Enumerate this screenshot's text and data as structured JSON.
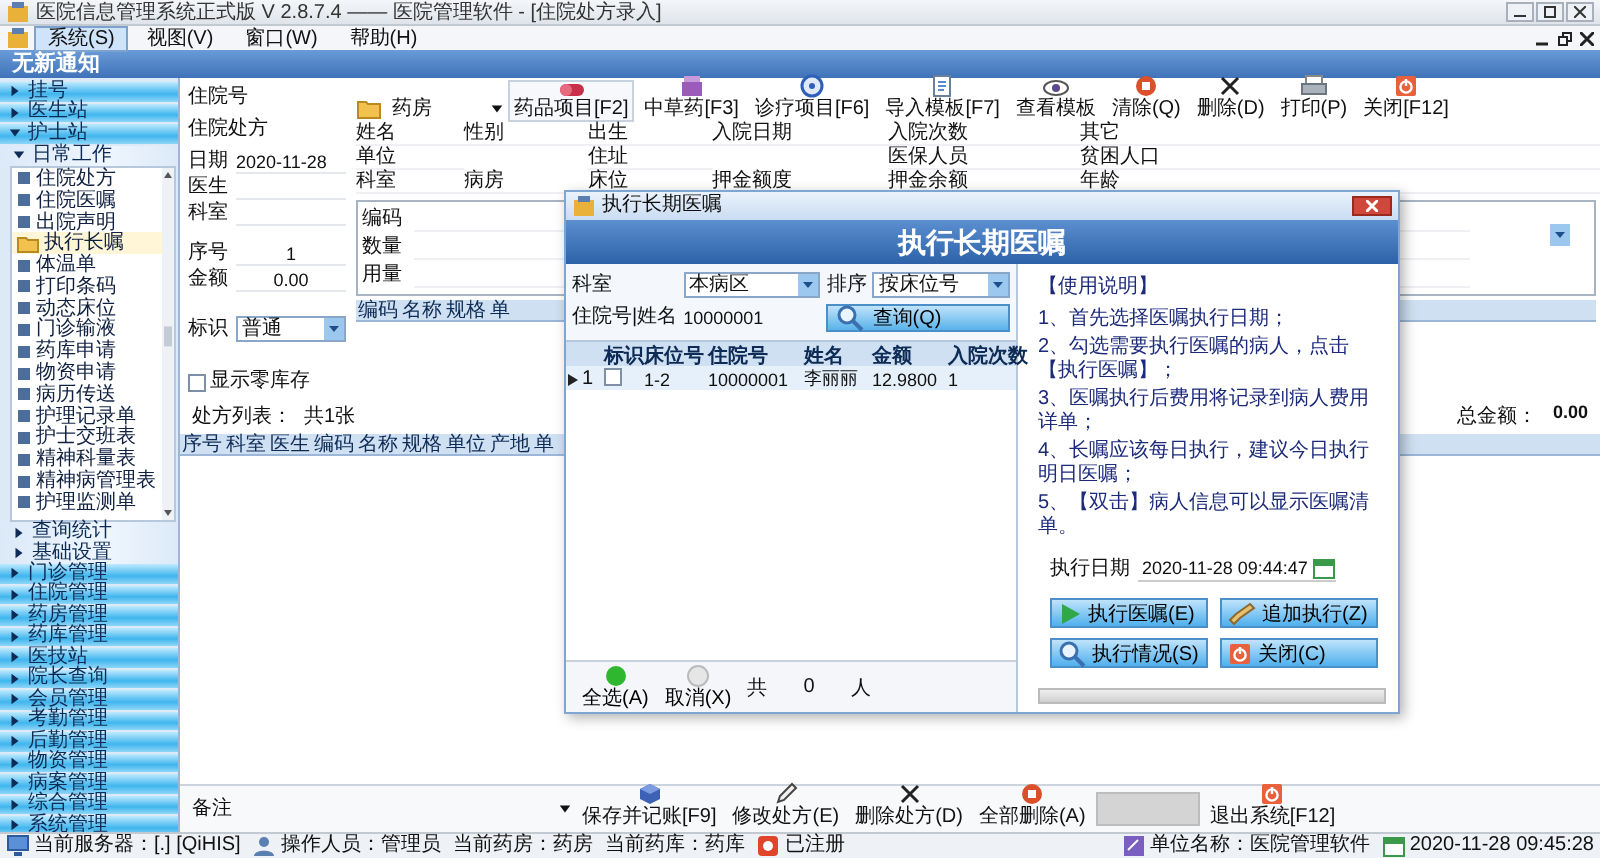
{
  "window": {
    "title": "医院信息管理系统正式版 V 2.8.7.4 —— 医院管理软件 - [住院处方录入]"
  },
  "menu": [
    {
      "label": "系统(S)",
      "selected": true
    },
    {
      "label": "视图(V)",
      "selected": false
    },
    {
      "label": "窗口(W)",
      "selected": false
    },
    {
      "label": "帮助(H)",
      "selected": false
    }
  ],
  "banner": "无新通知",
  "sidebar": {
    "items": [
      {
        "label": "挂号",
        "expanded": false
      },
      {
        "label": "医生站",
        "expanded": false
      },
      {
        "label": "护士站",
        "expanded": true,
        "children": [
          {
            "label": "日常工作",
            "expanded": true,
            "children": [
              {
                "label": "住院处方",
                "selected": false
              },
              {
                "label": "住院医嘱",
                "selected": false
              },
              {
                "label": "出院声明",
                "selected": false
              },
              {
                "label": "执行长嘱",
                "selected": true
              },
              {
                "label": "体温单",
                "selected": false
              },
              {
                "label": "打印条码",
                "selected": false
              },
              {
                "label": "动态床位",
                "selected": false
              },
              {
                "label": "门诊输液",
                "selected": false
              },
              {
                "label": "药库申请",
                "selected": false
              },
              {
                "label": "物资申请",
                "selected": false
              },
              {
                "label": "病历传送",
                "selected": false
              },
              {
                "label": "护理记录单",
                "selected": false
              },
              {
                "label": "护士交班表",
                "selected": false
              },
              {
                "label": "精神科量表",
                "selected": false
              },
              {
                "label": "精神病管理表",
                "selected": false
              },
              {
                "label": "护理监测单",
                "selected": false
              }
            ]
          },
          {
            "label": "查询统计",
            "expanded": false
          },
          {
            "label": "基础设置",
            "expanded": false
          }
        ]
      },
      {
        "label": "门诊管理",
        "expanded": false
      },
      {
        "label": "住院管理",
        "expanded": false
      },
      {
        "label": "药房管理",
        "expanded": false
      },
      {
        "label": "药库管理",
        "expanded": false
      },
      {
        "label": "医技站",
        "expanded": false
      },
      {
        "label": "院长查询",
        "expanded": false
      },
      {
        "label": "会员管理",
        "expanded": false
      },
      {
        "label": "考勤管理",
        "expanded": false
      },
      {
        "label": "后勤管理",
        "expanded": false
      },
      {
        "label": "物资管理",
        "expanded": false
      },
      {
        "label": "病案管理",
        "expanded": false
      },
      {
        "label": "综合管理",
        "expanded": false
      },
      {
        "label": "系统管理",
        "expanded": false
      }
    ]
  },
  "form": {
    "admission_label": "住院号",
    "prescription_label": "住院处方",
    "fields": [
      {
        "label": "日期",
        "value": "2020-11-28"
      },
      {
        "label": "医生"
      },
      {
        "label": "科室"
      },
      {
        "label": "序号",
        "value": "1"
      },
      {
        "label": "金额",
        "value": "0.00"
      }
    ],
    "flag": {
      "label": "标识",
      "value": "普通"
    },
    "zero_stock": {
      "label": "显示零库存",
      "checked": false
    },
    "list_label": "处方列表：",
    "list_count": "共1张"
  },
  "toolbar": {
    "pharmacy": "药房",
    "buttons": [
      "药品项目[F2]",
      "中草药[F3]",
      "诊疗项目[F6]",
      "导入模板[F7]",
      "查看模板",
      "清除(Q)",
      "删除(D)",
      "打印(P)",
      "关闭[F12]"
    ]
  },
  "patient_info": [
    [
      "姓名",
      "性别",
      "出生",
      "入院日期",
      "入院次数",
      "其它"
    ],
    [
      "单位",
      "住址",
      "医保人员",
      "贫困人口"
    ],
    [
      "科室",
      "病房",
      "床位",
      "押金额度",
      "押金余额",
      "年龄"
    ]
  ],
  "order_box": {
    "labels": [
      "编码",
      "数量",
      "用量"
    ],
    "columns": [
      "编码",
      "名称",
      "规格",
      "单"
    ]
  },
  "total": {
    "label": "总金额：",
    "value": "0.00"
  },
  "table": {
    "columns": [
      "序号",
      "科室",
      "医生",
      "编码",
      "名称",
      "规格",
      "单位",
      "产地",
      "单"
    ]
  },
  "bottom_bar": {
    "remark_label": "备注",
    "buttons": [
      "保存并记账[F9]",
      "修改处方(E)",
      "删除处方(D)",
      "全部删除(A)",
      "退出系统[F12]"
    ]
  },
  "dialog": {
    "title": "执行长期医嘱",
    "heading": "执行长期医嘱",
    "dept": {
      "label": "科室",
      "value": "本病区"
    },
    "sort": {
      "label": "排序",
      "value": "按床位号"
    },
    "search": {
      "label": "住院号|姓名",
      "value": "10000001"
    },
    "search_button": "查询(Q)",
    "flag_column": "标识",
    "columns": [
      "床位号",
      "住院号",
      "姓名",
      "金额",
      "入院次数"
    ],
    "rows": [
      {
        "index": "1",
        "selected": true,
        "checked": false,
        "cells": [
          "1-2",
          "10000001",
          "李丽丽",
          "12.9800",
          "1"
        ]
      }
    ],
    "select_all": "全选(A)",
    "cancel": "取消(X)",
    "count_prefix": "共",
    "count": "0",
    "count_suffix": "人",
    "help_title": "【使用说明】",
    "help": [
      "1、首先选择医嘱执行日期；",
      "2、勾选需要执行医嘱的病人，点击【执行医嘱】；",
      "3、医嘱执行后费用将记录到病人费用详单；",
      "4、长嘱应该每日执行，建议今日执行明日医嘱；",
      "5、【双击】病人信息可以显示医嘱清单。"
    ],
    "date": {
      "label": "执行日期",
      "value": "2020-11-28 09:44:47"
    },
    "buttons": [
      "执行医嘱(E)",
      "追加执行(Z)",
      "执行情况(S)",
      "关闭(C)"
    ],
    "progress": {
      "level": 0
    }
  },
  "status_bar": {
    "items": [
      "当前服务器：[.] [QiHIS]",
      "操作人员：管理员",
      "当前药房：药房",
      "当前药库：药库",
      "已注册"
    ],
    "unit": "单位名称：医院管理软件",
    "time": "2020-11-28 09:45:28"
  }
}
